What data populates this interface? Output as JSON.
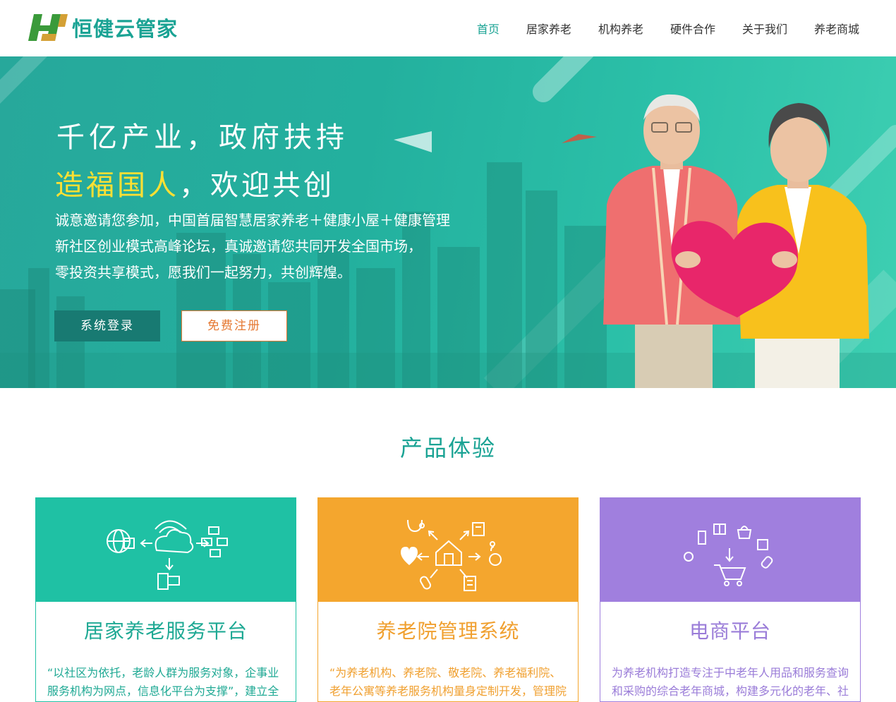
{
  "brand": {
    "name": "恒健云管家"
  },
  "nav": {
    "items": [
      {
        "label": "首页",
        "active": true
      },
      {
        "label": "居家养老"
      },
      {
        "label": "机构养老"
      },
      {
        "label": "硬件合作"
      },
      {
        "label": "关于我们"
      },
      {
        "label": "养老商城"
      }
    ]
  },
  "hero": {
    "title_line1": "千亿产业，政府扶持",
    "title_line2_highlight": "造福国人",
    "title_line2_rest": "，欢迎共创",
    "desc_lines": [
      "诚意邀请您参加，中国首届智慧居家养老＋健康小屋＋健康管理",
      "新社区创业模式高峰论坛，真诚邀请您共同开发全国市场，",
      "零投资共享模式，愿我们一起努力，共创辉煌。"
    ],
    "login_label": "系统登录",
    "register_label": "免费注册"
  },
  "products": {
    "section_title": "产品体验",
    "cards": [
      {
        "title": "居家养老服务平台",
        "desc": "“以社区为依托，老龄人群为服务对象，企事业服务机构为网点，信息化平台为支撑”，建立全",
        "color": "#1fc1a4"
      },
      {
        "title": "养老院管理系统",
        "desc": "“为养老机构、养老院、敬老院、养老福利院、老年公寓等养老服务机构量身定制开发，管理院",
        "color": "#f4a62e"
      },
      {
        "title": "电商平台",
        "desc": "为养老机构打造专注于中老年人用品和服务查询和采购的综合老年商城，构建多元化的老年、社",
        "color": "#a07fde"
      }
    ]
  },
  "colors": {
    "brand": "#1aa394",
    "login_bg": "#187a72",
    "register_border": "#e57832",
    "highlight": "#ffe033"
  }
}
